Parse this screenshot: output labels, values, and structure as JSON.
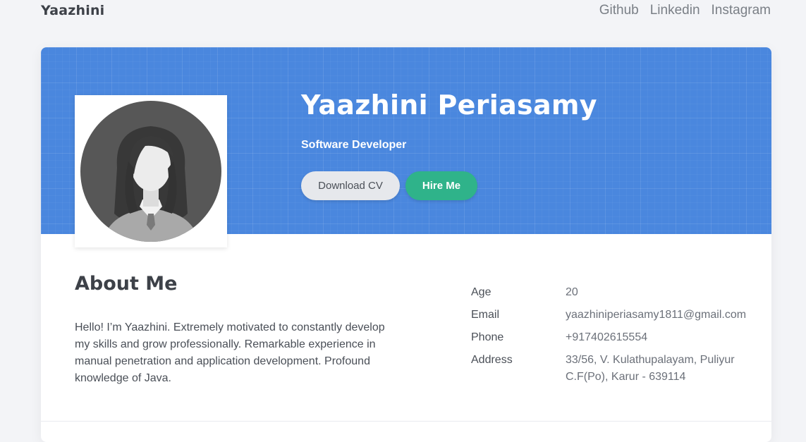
{
  "header": {
    "brand": "Yaazhini",
    "nav": [
      {
        "label": "Github"
      },
      {
        "label": "Linkedin"
      },
      {
        "label": "Instagram"
      }
    ]
  },
  "hero": {
    "name": "Yaazhini Periasamy",
    "role": "Software Developer",
    "download_label": "Download CV",
    "hire_label": "Hire Me",
    "avatar_icon": "female-avatar-icon",
    "accent_color": "#4a87de",
    "hire_color": "#2fb38a"
  },
  "about": {
    "title": "About Me",
    "text": "Hello! I’m Yaazhini. Extremely motivated to constantly develop my skills and grow professionally. Remarkable experience in manual penetration and application development. Profound knowledge of Java."
  },
  "info": [
    {
      "label": "Age",
      "value": "20"
    },
    {
      "label": "Email",
      "value": "yaazhiniperiasamy1811@gmail.com"
    },
    {
      "label": "Phone",
      "value": "+917402615554"
    },
    {
      "label": "Address",
      "value": "33/56, V. Kulathupalayam, Puliyur C.F(Po), Karur - 639114"
    }
  ]
}
